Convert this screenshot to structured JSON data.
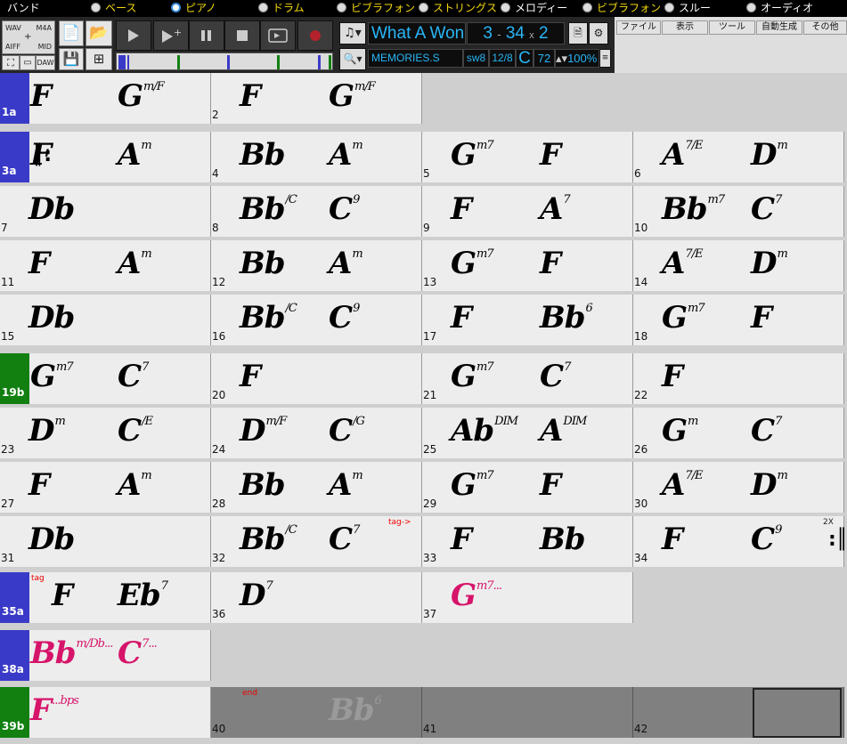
{
  "tracks": [
    {
      "label": "バンド",
      "selected": false,
      "color": "#ffffff"
    },
    {
      "label": "ベース",
      "selected": false,
      "color": "#f5d90a"
    },
    {
      "label": "ピアノ",
      "selected": true,
      "color": "#f5d90a"
    },
    {
      "label": "ドラム",
      "selected": false,
      "color": "#f5d90a"
    },
    {
      "label": "ビブラフォン",
      "selected": false,
      "color": "#f5d90a"
    },
    {
      "label": "ストリングス",
      "selected": false,
      "color": "#f5d90a"
    },
    {
      "label": "メロディー",
      "selected": false,
      "color": "#ffffff"
    },
    {
      "label": "ビブラフォン",
      "selected": false,
      "color": "#f5d90a"
    },
    {
      "label": "スルー",
      "selected": false,
      "color": "#ffffff"
    },
    {
      "label": "オーディオ",
      "selected": false,
      "color": "#ffffff"
    }
  ],
  "left_panel": {
    "wav": "WAV",
    "m4a": "M4A",
    "aiff": "AIFF",
    "mid": "MID",
    "daw": "DAW"
  },
  "song": {
    "title": "What A Won",
    "bar_start": "3",
    "bar_sep": "-",
    "bar_end": "34",
    "times_sign": "x",
    "times": "2",
    "style": "MEMORIES.S",
    "style_ext": "sw8",
    "time_sig": "12/8",
    "key": "C",
    "tempo": "72",
    "zoom": "100%"
  },
  "menus": [
    "ファイル",
    "表示",
    "ツール",
    "自動生成",
    "その他"
  ],
  "sections": {
    "1a": "#3a3ac8",
    "3a": "#3a3ac8",
    "19b": "#118011",
    "35a": "#3a3ac8",
    "38a": "#3a3ac8",
    "39b": "#118011"
  },
  "rows": [
    [
      {
        "n": "1a",
        "sect": "1a",
        "chords": [
          [
            "F",
            ""
          ],
          [
            "G",
            "m/F"
          ]
        ]
      },
      {
        "n": "2",
        "chords": [
          [
            "F",
            ""
          ],
          [
            "G",
            "m/F"
          ]
        ]
      }
    ],
    [
      {
        "n": "3a",
        "sect": "3a",
        "chords": [
          [
            "F",
            ""
          ],
          [
            "A",
            "m"
          ]
        ]
      },
      {
        "n": "4",
        "chords": [
          [
            "Bb",
            ""
          ],
          [
            "A",
            "m"
          ]
        ]
      },
      {
        "n": "5",
        "chords": [
          [
            "G",
            "m7"
          ],
          [
            "F",
            ""
          ]
        ]
      },
      {
        "n": "6",
        "chords": [
          [
            "A",
            "7/E"
          ],
          [
            "D",
            "m"
          ]
        ]
      }
    ],
    [
      {
        "n": "7",
        "chords": [
          [
            "Db",
            ""
          ]
        ]
      },
      {
        "n": "8",
        "chords": [
          [
            "Bb",
            "/C"
          ],
          [
            "C",
            "9"
          ]
        ]
      },
      {
        "n": "9",
        "chords": [
          [
            "F",
            ""
          ],
          [
            "A",
            "7"
          ]
        ]
      },
      {
        "n": "10",
        "chords": [
          [
            "Bb",
            "m7"
          ],
          [
            "C",
            "7"
          ]
        ]
      }
    ],
    [
      {
        "n": "11",
        "chords": [
          [
            "F",
            ""
          ],
          [
            "A",
            "m"
          ]
        ]
      },
      {
        "n": "12",
        "chords": [
          [
            "Bb",
            ""
          ],
          [
            "A",
            "m"
          ]
        ]
      },
      {
        "n": "13",
        "chords": [
          [
            "G",
            "m7"
          ],
          [
            "F",
            ""
          ]
        ]
      },
      {
        "n": "14",
        "chords": [
          [
            "A",
            "7/E"
          ],
          [
            "D",
            "m"
          ]
        ]
      }
    ],
    [
      {
        "n": "15",
        "chords": [
          [
            "Db",
            ""
          ]
        ]
      },
      {
        "n": "16",
        "chords": [
          [
            "Bb",
            "/C"
          ],
          [
            "C",
            "9"
          ]
        ]
      },
      {
        "n": "17",
        "chords": [
          [
            "F",
            ""
          ],
          [
            "Bb",
            "6"
          ]
        ]
      },
      {
        "n": "18",
        "chords": [
          [
            "G",
            "m7"
          ],
          [
            "F",
            ""
          ]
        ]
      }
    ],
    [
      {
        "n": "19b",
        "sect": "19b",
        "chords": [
          [
            "G",
            "m7"
          ],
          [
            "C",
            "7"
          ]
        ]
      },
      {
        "n": "20",
        "chords": [
          [
            "F",
            ""
          ]
        ]
      },
      {
        "n": "21",
        "chords": [
          [
            "G",
            "m7"
          ],
          [
            "C",
            "7"
          ]
        ]
      },
      {
        "n": "22",
        "chords": [
          [
            "F",
            ""
          ]
        ]
      }
    ],
    [
      {
        "n": "23",
        "chords": [
          [
            "D",
            "m"
          ],
          [
            "C",
            "/E"
          ]
        ]
      },
      {
        "n": "24",
        "chords": [
          [
            "D",
            "m/F"
          ],
          [
            "C",
            "/G"
          ]
        ]
      },
      {
        "n": "25",
        "chords": [
          [
            "Ab",
            "DIM"
          ],
          [
            "A",
            "DIM"
          ]
        ]
      },
      {
        "n": "26",
        "chords": [
          [
            "G",
            "m"
          ],
          [
            "C",
            "7"
          ]
        ]
      }
    ],
    [
      {
        "n": "27",
        "chords": [
          [
            "F",
            ""
          ],
          [
            "A",
            "m"
          ]
        ]
      },
      {
        "n": "28",
        "chords": [
          [
            "Bb",
            ""
          ],
          [
            "A",
            "m"
          ]
        ]
      },
      {
        "n": "29",
        "chords": [
          [
            "G",
            "m7"
          ],
          [
            "F",
            ""
          ]
        ]
      },
      {
        "n": "30",
        "chords": [
          [
            "A",
            "7/E"
          ],
          [
            "D",
            "m"
          ]
        ]
      }
    ],
    [
      {
        "n": "31",
        "chords": [
          [
            "Db",
            ""
          ]
        ]
      },
      {
        "n": "32",
        "chords": [
          [
            "Bb",
            "/C"
          ],
          [
            "C",
            "7"
          ]
        ]
      },
      {
        "n": "33",
        "chords": [
          [
            "F",
            ""
          ],
          [
            "Bb",
            ""
          ]
        ]
      },
      {
        "n": "34",
        "chords": [
          [
            "F",
            ""
          ],
          [
            "C",
            "9"
          ]
        ]
      }
    ],
    [
      {
        "n": "35a",
        "sect": "35a",
        "chords": [
          [
            "F",
            ""
          ],
          [
            "Eb",
            "7"
          ]
        ]
      },
      {
        "n": "36",
        "chords": [
          [
            "D",
            "7"
          ]
        ]
      },
      {
        "n": "37",
        "pink": true,
        "chords": [
          [
            "G",
            "m7..."
          ]
        ]
      }
    ],
    [
      {
        "n": "38a",
        "sect": "38a",
        "pink": true,
        "chords": [
          [
            "Bb",
            "m/Db..."
          ],
          [
            "C",
            "7..."
          ]
        ]
      }
    ],
    [
      {
        "n": "39b",
        "sect": "39b",
        "pink": true,
        "chords": [
          [
            "F",
            "...bps"
          ]
        ]
      },
      {
        "n": "40",
        "ext": true,
        "ghost": true,
        "chords": [
          [
            "",
            ""
          ],
          [
            "Bb",
            "6"
          ]
        ]
      },
      {
        "n": "41",
        "ext": true,
        "chords": []
      },
      {
        "n": "42",
        "ext": true,
        "chords": []
      }
    ]
  ],
  "markers": {
    "tag_to": "tag->",
    "tag": "tag",
    "end": "end",
    "repeat_count": "2X"
  }
}
